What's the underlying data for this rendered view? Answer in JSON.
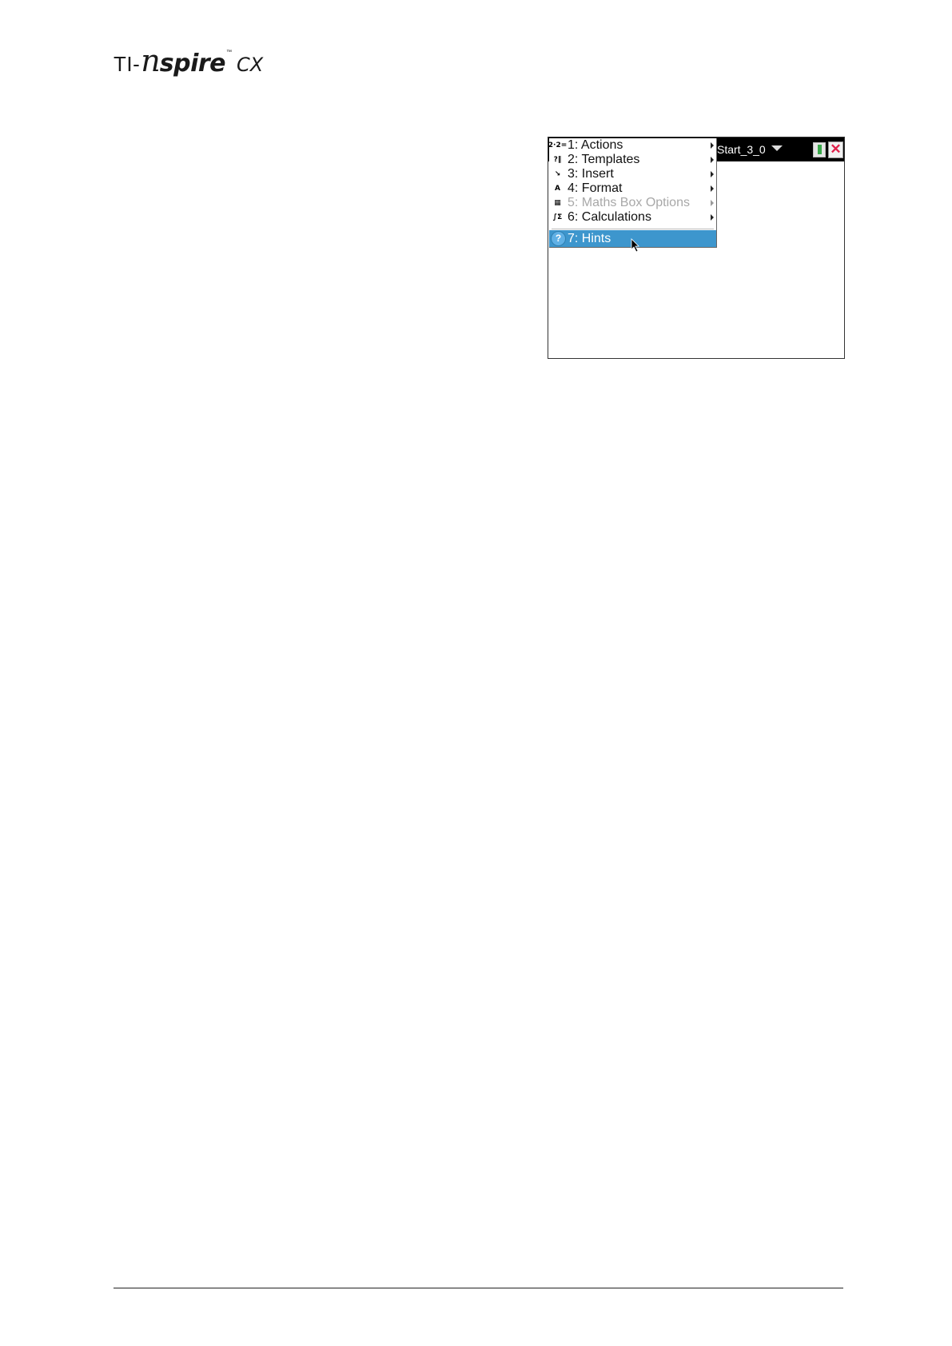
{
  "logo": {
    "ti": "TI-",
    "n": "n",
    "spire": "spire",
    "tm": "™",
    "cx": "CX"
  },
  "titlebar": {
    "document_title": "Start_3_0",
    "dropdown_icon": "chevron-down-icon",
    "battery_icon": "battery-icon",
    "close_icon_glyph": "✕"
  },
  "menu": {
    "items": [
      {
        "label": "1: Actions",
        "icon": "2·2=",
        "has_submenu": true,
        "enabled": true
      },
      {
        "label": "2: Templates",
        "icon": "?‖",
        "has_submenu": true,
        "enabled": true
      },
      {
        "label": "3: Insert",
        "icon": "↘",
        "has_submenu": true,
        "enabled": true
      },
      {
        "label": "4: Format",
        "icon": "A",
        "has_submenu": true,
        "enabled": true
      },
      {
        "label": "5: Maths Box Options",
        "icon": "▦",
        "has_submenu": true,
        "enabled": false
      },
      {
        "label": "6: Calculations",
        "icon": "∫Σ",
        "has_submenu": true,
        "enabled": true
      }
    ],
    "selected_item": {
      "label": "7: Hints",
      "icon": "?"
    }
  },
  "colors": {
    "selection": "#3d96cd",
    "titlebar": "#000000"
  }
}
